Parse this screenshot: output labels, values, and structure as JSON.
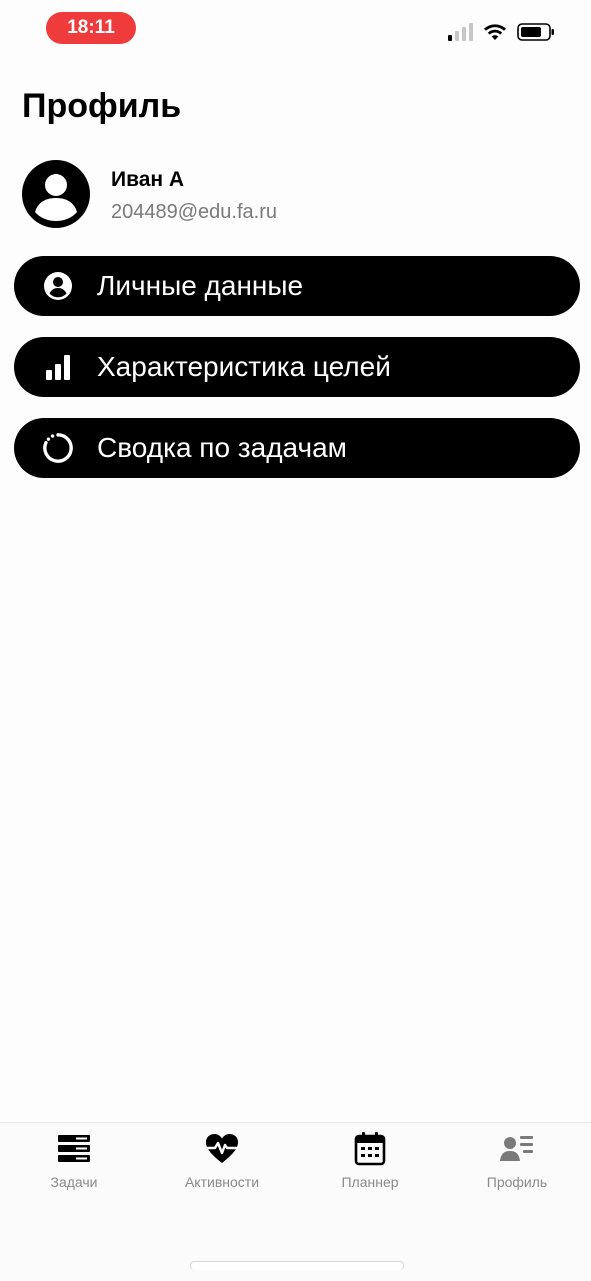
{
  "status_bar": {
    "time": "18:11"
  },
  "page": {
    "title": "Профиль"
  },
  "user": {
    "name": "Иван А",
    "email": "204489@edu.fa.ru"
  },
  "menu": {
    "items": [
      {
        "label": "Личные данные",
        "icon": "person-circle-icon"
      },
      {
        "label": "Характеристика целей",
        "icon": "bar-chart-icon"
      },
      {
        "label": "Сводка по задачам",
        "icon": "progress-ring-icon"
      }
    ]
  },
  "tab_bar": {
    "tabs": [
      {
        "label": "Задачи",
        "icon": "tasks-stack-icon"
      },
      {
        "label": "Активности",
        "icon": "heart-pulse-icon"
      },
      {
        "label": "Планнер",
        "icon": "calendar-icon"
      },
      {
        "label": "Профиль",
        "icon": "profile-list-icon"
      }
    ]
  },
  "colors": {
    "time_pill": "#ef3b3b",
    "button_bg": "#000000",
    "button_text": "#ffffff",
    "secondary_text": "#7a7a7a",
    "tab_label": "#8a8a8a"
  }
}
